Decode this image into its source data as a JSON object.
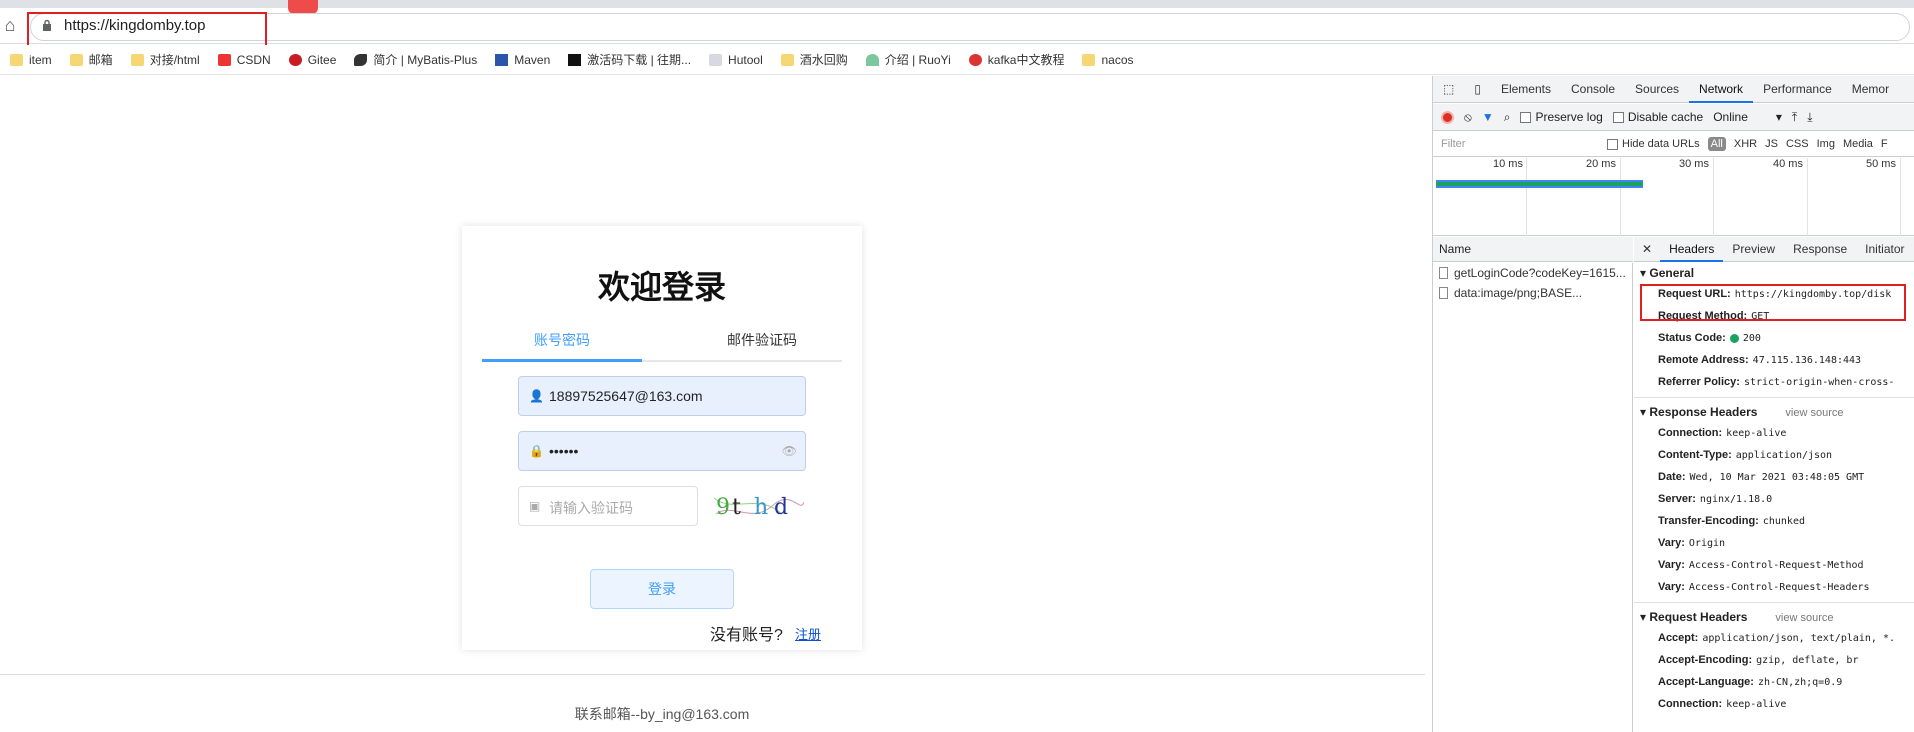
{
  "browser": {
    "url": "https://kingdomby.top",
    "bookmarks": [
      "item",
      "邮箱",
      "对接/html",
      "CSDN",
      "Gitee",
      "简介 | MyBatis-Plus",
      "Maven",
      "激活码下载 | 往期...",
      "Hutool",
      "酒水回购",
      "介绍 | RuoYi",
      "kafka中文教程",
      "nacos"
    ]
  },
  "login": {
    "title": "欢迎登录",
    "tab_account": "账号密码",
    "tab_email": "邮件验证码",
    "username_value": "18897525647@163.com",
    "password_value": "••••••",
    "captcha_placeholder": "请输入验证码",
    "captcha_text": "9th d",
    "login_button": "登录",
    "no_account": "没有账号?",
    "register_link": "注册",
    "footer": "联系邮箱--by_ing@163.com"
  },
  "devtools": {
    "tabs": [
      "Elements",
      "Console",
      "Sources",
      "Network",
      "Performance",
      "Memor"
    ],
    "active_tab": "Network",
    "toolbar": {
      "preserve_log": "Preserve log",
      "disable_cache": "Disable cache",
      "throttle": "Online"
    },
    "filter_placeholder": "Filter",
    "hide_data_urls": "Hide data URLs",
    "types": [
      "All",
      "XHR",
      "JS",
      "CSS",
      "Img",
      "Media",
      "F"
    ],
    "ticks": [
      "10 ms",
      "20 ms",
      "30 ms",
      "40 ms",
      "50 ms"
    ],
    "name_header": "Name",
    "requests": [
      "getLoginCode?codeKey=1615...",
      "data:image/png;BASE..."
    ],
    "detail_tabs": [
      "Headers",
      "Preview",
      "Response",
      "Initiator"
    ],
    "general_label": "General",
    "general": [
      {
        "k": "Request URL:",
        "v": "https://kingdomby.top/disk"
      },
      {
        "k": "Request Method:",
        "v": "GET"
      },
      {
        "k": "Status Code:",
        "v": "200"
      },
      {
        "k": "Remote Address:",
        "v": "47.115.136.148:443"
      },
      {
        "k": "Referrer Policy:",
        "v": "strict-origin-when-cross-"
      }
    ],
    "response_headers_label": "Response Headers",
    "view_source": "view source",
    "response_headers": [
      {
        "k": "Connection:",
        "v": "keep-alive"
      },
      {
        "k": "Content-Type:",
        "v": "application/json"
      },
      {
        "k": "Date:",
        "v": "Wed, 10 Mar 2021 03:48:05 GMT"
      },
      {
        "k": "Server:",
        "v": "nginx/1.18.0"
      },
      {
        "k": "Transfer-Encoding:",
        "v": "chunked"
      },
      {
        "k": "Vary:",
        "v": "Origin"
      },
      {
        "k": "Vary:",
        "v": "Access-Control-Request-Method"
      },
      {
        "k": "Vary:",
        "v": "Access-Control-Request-Headers"
      }
    ],
    "request_headers_label": "Request Headers",
    "request_headers": [
      {
        "k": "Accept:",
        "v": "application/json, text/plain, *."
      },
      {
        "k": "Accept-Encoding:",
        "v": "gzip, deflate, br"
      },
      {
        "k": "Accept-Language:",
        "v": "zh-CN,zh;q=0.9"
      },
      {
        "k": "Connection:",
        "v": "keep-alive"
      }
    ]
  },
  "colors": {
    "accent": "#409eff",
    "annotation": "#e02020"
  }
}
